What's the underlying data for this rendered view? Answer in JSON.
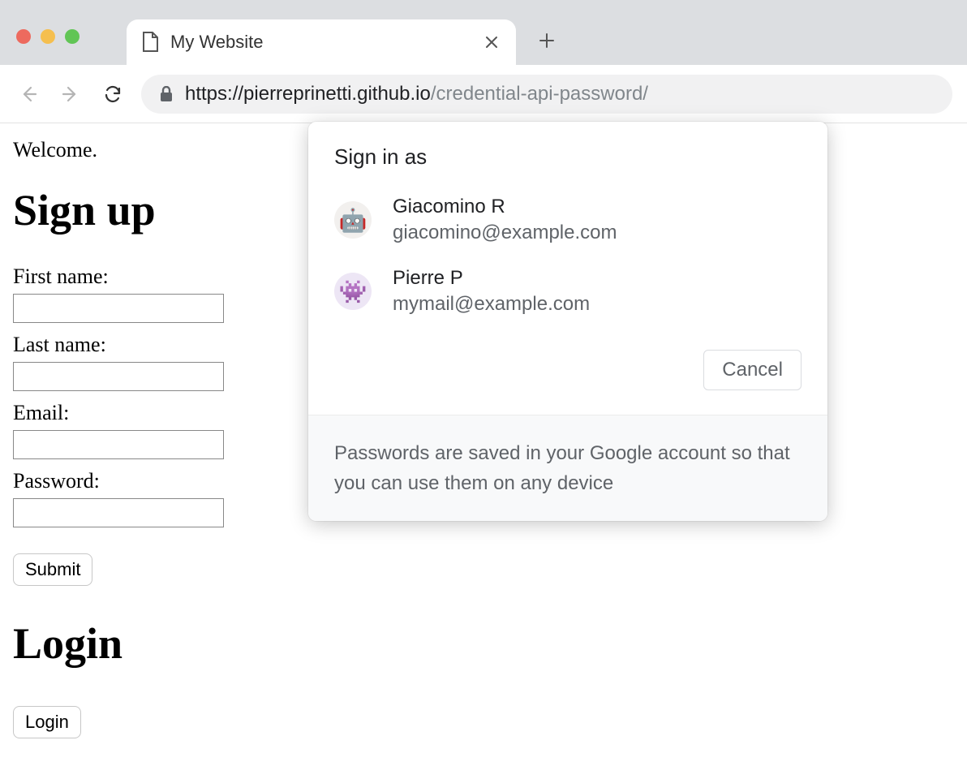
{
  "browser": {
    "tab_title": "My Website",
    "url_scheme_host": "https://pierreprinetti.github.io",
    "url_path": "/credential-api-password/"
  },
  "page": {
    "welcome": "Welcome.",
    "signup_heading": "Sign up",
    "labels": {
      "first_name": "First name:",
      "last_name": "Last name:",
      "email": "Email:",
      "password": "Password:"
    },
    "submit_label": "Submit",
    "login_heading": "Login",
    "login_button_label": "Login"
  },
  "credential_popup": {
    "title": "Sign in as",
    "accounts": [
      {
        "name": "Giacomino R",
        "email": "giacomino@example.com",
        "avatar_icon": "🤖"
      },
      {
        "name": "Pierre P",
        "email": "mymail@example.com",
        "avatar_icon": "👾"
      }
    ],
    "cancel_label": "Cancel",
    "footer": "Passwords are saved in your Google account so that you can use them on any device"
  }
}
